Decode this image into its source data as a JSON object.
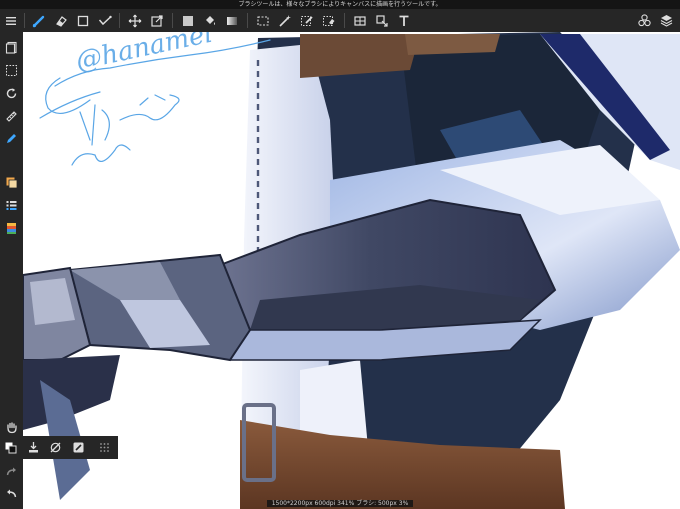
{
  "hint_bar": {
    "text": "ブラシツールは、様々なブラシによりキャンバスに描画を行うツールです。"
  },
  "toolbar": {
    "left_icons": [
      "menu-icon",
      "brush-icon",
      "eraser-icon",
      "rect-shape-icon",
      "correction-icon",
      "move-icon",
      "transform-icon",
      "fill-color-icon",
      "bucket-icon",
      "gradient-icon",
      "select-rect-icon",
      "magic-wand-icon",
      "select-pen-icon",
      "select-eraser-icon",
      "filter-icon",
      "lasso-fill-icon",
      "text-icon"
    ],
    "right_icons": [
      "materials-icon",
      "layers-icon"
    ],
    "accent": "#3ea7ff"
  },
  "sidebar": {
    "icons": [
      "layer-list-icon",
      "selection-icon",
      "rotate-icon",
      "ruler-icon",
      "pen-icon",
      "color-icon",
      "brush-list-icon",
      "palette-icon",
      "hand-icon",
      "redo-icon",
      "undo-icon"
    ]
  },
  "sub_toolbar": {
    "icons": [
      "color-swap-icon",
      "import-icon",
      "snap-off-icon",
      "stabilizer-icon",
      "grid-icon"
    ]
  },
  "canvas": {
    "signature_text": "@hanamel"
  },
  "status_bar": {
    "text": "1500*2200px 600dpi 341% ブラシ: 500px 3%"
  }
}
